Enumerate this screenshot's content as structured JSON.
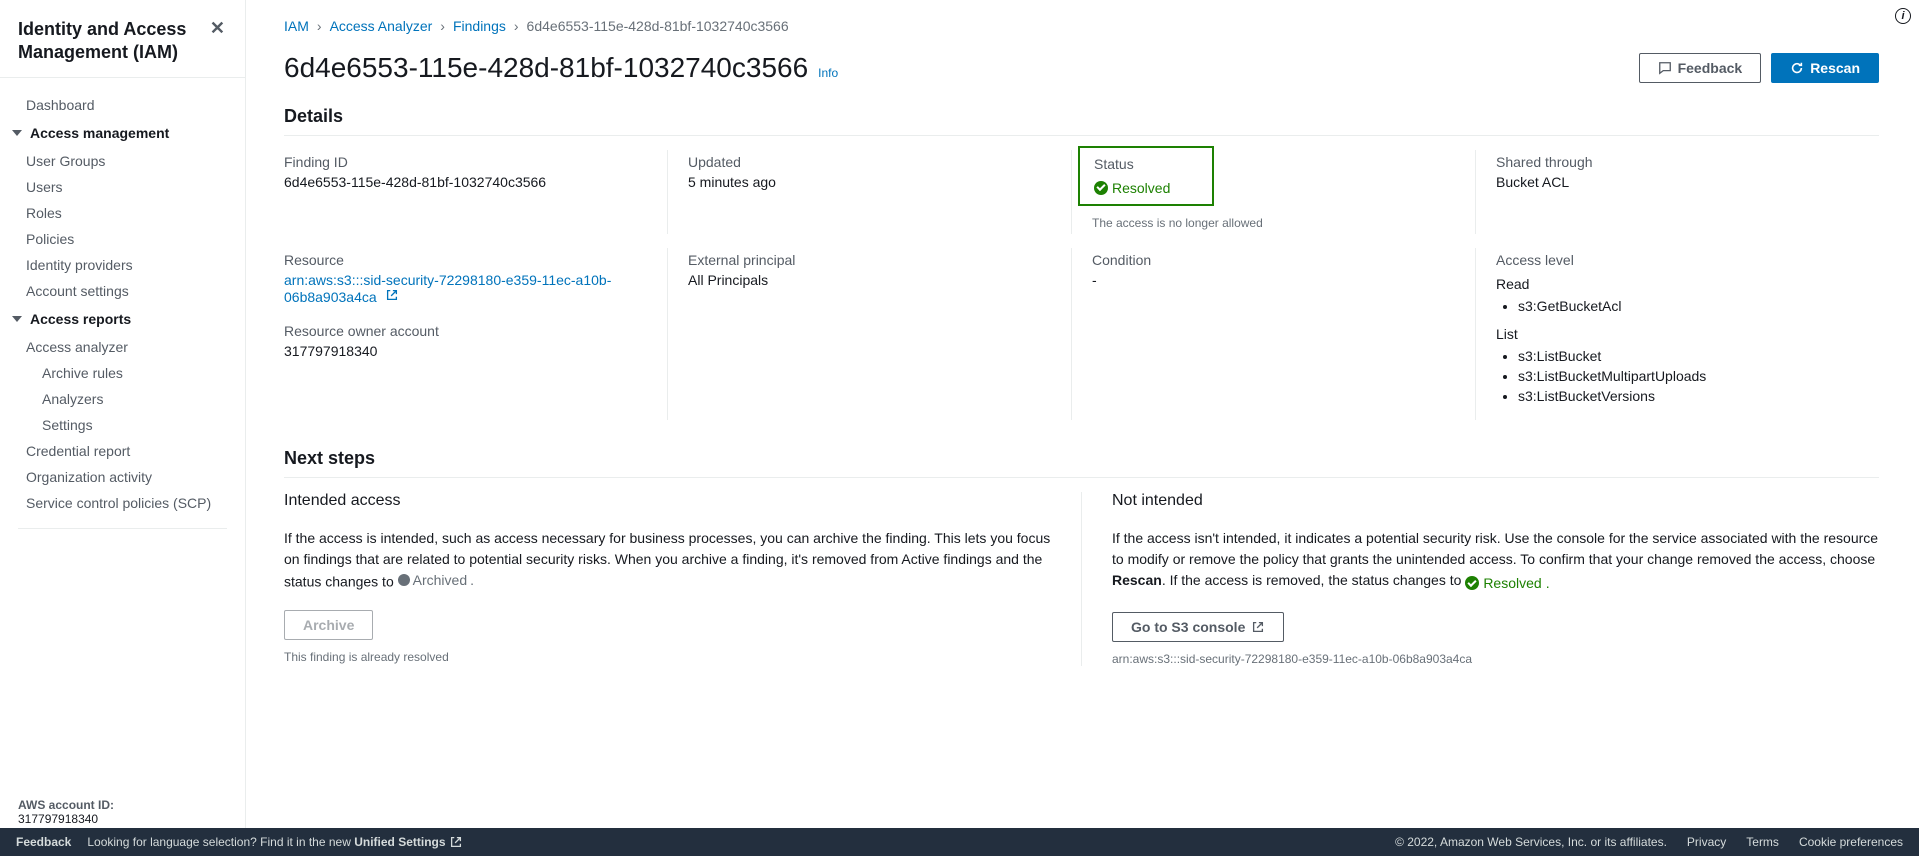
{
  "sidebar": {
    "title": "Identity and Access Management (IAM)",
    "dashboard": "Dashboard",
    "group_access_mgmt": "Access management",
    "ug": "User Groups",
    "users": "Users",
    "roles": "Roles",
    "policies": "Policies",
    "idp": "Identity providers",
    "acct_settings": "Account settings",
    "group_reports": "Access reports",
    "analyzer": "Access analyzer",
    "archive_rules": "Archive rules",
    "analyzers": "Analyzers",
    "settings": "Settings",
    "cred_report": "Credential report",
    "org_activity": "Organization activity",
    "scp": "Service control policies (SCP)",
    "account_label": "AWS account ID:",
    "account_id": "317797918340"
  },
  "breadcrumb": {
    "iam": "IAM",
    "analyzer": "Access Analyzer",
    "findings": "Findings",
    "current": "6d4e6553-115e-428d-81bf-1032740c3566"
  },
  "header": {
    "title": "6d4e6553-115e-428d-81bf-1032740c3566",
    "info": "Info",
    "feedback": "Feedback",
    "rescan": "Rescan"
  },
  "details": {
    "title": "Details",
    "finding_id_label": "Finding ID",
    "finding_id": "6d4e6553-115e-428d-81bf-1032740c3566",
    "updated_label": "Updated",
    "updated": "5 minutes ago",
    "status_label": "Status",
    "status_value": "Resolved",
    "status_help": "The access is no longer allowed",
    "shared_label": "Shared through",
    "shared_value": "Bucket ACL",
    "resource_label": "Resource",
    "resource_arn": "arn:aws:s3:::sid-security-72298180-e359-11ec-a10b-06b8a903a4ca",
    "owner_label": "Resource owner account",
    "owner": "317797918340",
    "ext_principal_label": "External principal",
    "ext_principal": "All Principals",
    "condition_label": "Condition",
    "condition": "-",
    "access_level_label": "Access level",
    "read_label": "Read",
    "read_items": [
      "s3:GetBucketAcl"
    ],
    "list_label": "List",
    "list_items": [
      "s3:ListBucket",
      "s3:ListBucketMultipartUploads",
      "s3:ListBucketVersions"
    ]
  },
  "next": {
    "title": "Next steps",
    "intended_heading": "Intended access",
    "intended_body_1": "If the access is intended, such as access necessary for business processes, you can archive the finding. This lets you focus on findings that are related to potential security risks. When you archive a finding, it's removed from Active findings and the status changes to ",
    "archived_pill": "Archived",
    "archive_btn": "Archive",
    "archive_note": "This finding is already resolved",
    "not_intended_heading": "Not intended",
    "not_body_1": "If the access isn't intended, it indicates a potential security risk. Use the console for the service associated with the resource to modify or remove the policy that grants the unintended access. To confirm that your change removed the access, choose ",
    "rescan_bold": "Rescan",
    "not_body_2": ". If the access is removed, the status changes to ",
    "resolved_pill": "Resolved",
    "s3_btn": "Go to S3 console",
    "s3_arn": "arn:aws:s3:::sid-security-72298180-e359-11ec-a10b-06b8a903a4ca"
  },
  "footer": {
    "feedback": "Feedback",
    "lang_text": "Looking for language selection? Find it in the new ",
    "unified": "Unified Settings",
    "copyright": "© 2022, Amazon Web Services, Inc. or its affiliates.",
    "privacy": "Privacy",
    "terms": "Terms",
    "cookie": "Cookie preferences"
  }
}
